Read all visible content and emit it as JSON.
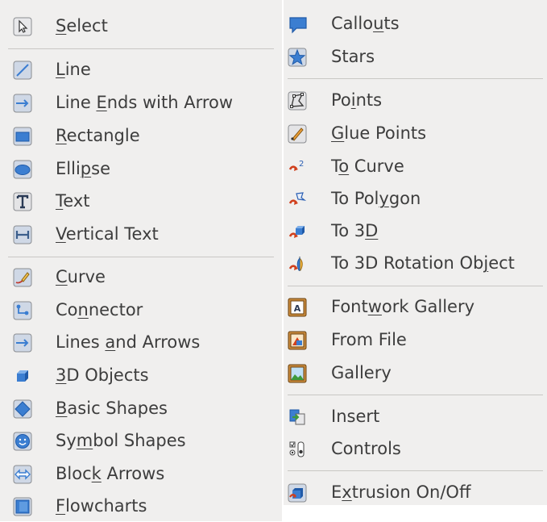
{
  "left_menu": [
    {
      "pre": "",
      "key": "S",
      "post": "elect",
      "icon": "select-pointer-icon"
    },
    {
      "pre": "",
      "key": "L",
      "post": "ine",
      "icon": "line-icon"
    },
    {
      "pre": "Line ",
      "key": "E",
      "post": "nds with Arrow",
      "icon": "arrow-right-icon"
    },
    {
      "pre": "",
      "key": "R",
      "post": "ectangle",
      "icon": "rectangle-icon"
    },
    {
      "pre": "Elli",
      "key": "p",
      "post": "se",
      "icon": "ellipse-icon"
    },
    {
      "pre": "",
      "key": "T",
      "post": "ext",
      "icon": "text-icon"
    },
    {
      "pre": "",
      "key": "V",
      "post": "ertical Text",
      "icon": "vertical-text-icon"
    },
    {
      "pre": "",
      "key": "C",
      "post": "urve",
      "icon": "curve-icon"
    },
    {
      "pre": "Co",
      "key": "n",
      "post": "nector",
      "icon": "connector-icon"
    },
    {
      "pre": "Lines ",
      "key": "a",
      "post": "nd Arrows",
      "icon": "lines-arrows-icon"
    },
    {
      "pre": "",
      "key": "3",
      "post": "D Objects",
      "icon": "cube-icon"
    },
    {
      "pre": "",
      "key": "B",
      "post": "asic Shapes",
      "icon": "diamond-icon"
    },
    {
      "pre": "Sy",
      "key": "m",
      "post": "bol Shapes",
      "icon": "smiley-icon"
    },
    {
      "pre": "Bloc",
      "key": "k",
      "post": " Arrows",
      "icon": "block-arrows-icon"
    },
    {
      "pre": "",
      "key": "F",
      "post": "lowcharts",
      "icon": "flowchart-icon"
    }
  ],
  "right_menu": [
    {
      "pre": "Callo",
      "key": "u",
      "post": "ts",
      "icon": "callout-icon"
    },
    {
      "pre": "Stars",
      "key": "",
      "post": "",
      "icon": "star-icon"
    },
    {
      "pre": "Po",
      "key": "i",
      "post": "nts",
      "icon": "points-icon"
    },
    {
      "pre": "",
      "key": "G",
      "post": "lue Points",
      "icon": "glue-points-icon"
    },
    {
      "pre": "T",
      "key": "o",
      "post": " Curve",
      "icon": "to-curve-icon"
    },
    {
      "pre": "To Pol",
      "key": "y",
      "post": "gon",
      "icon": "to-polygon-icon"
    },
    {
      "pre": "To 3",
      "key": "D",
      "post": "",
      "icon": "to-3d-icon"
    },
    {
      "pre": "To 3D Rotation Ob",
      "key": "j",
      "post": "ect",
      "icon": "to-3d-rotation-icon"
    },
    {
      "pre": "Font",
      "key": "w",
      "post": "ork Gallery",
      "icon": "fontwork-icon"
    },
    {
      "pre": "From File",
      "key": "",
      "post": "",
      "icon": "from-file-icon"
    },
    {
      "pre": "Gallery",
      "key": "",
      "post": "",
      "icon": "gallery-icon"
    },
    {
      "pre": "Insert",
      "key": "",
      "post": "",
      "icon": "insert-icon"
    },
    {
      "pre": "Controls",
      "key": "",
      "post": "",
      "icon": "controls-icon"
    },
    {
      "pre": "E",
      "key": "x",
      "post": "trusion On/Off",
      "icon": "extrusion-icon"
    }
  ],
  "colors": {
    "panel_bg": "#f0efee",
    "icon_blue": "#3b7ed1",
    "icon_frame": "#8a8c90",
    "text": "#3d3d3d"
  }
}
